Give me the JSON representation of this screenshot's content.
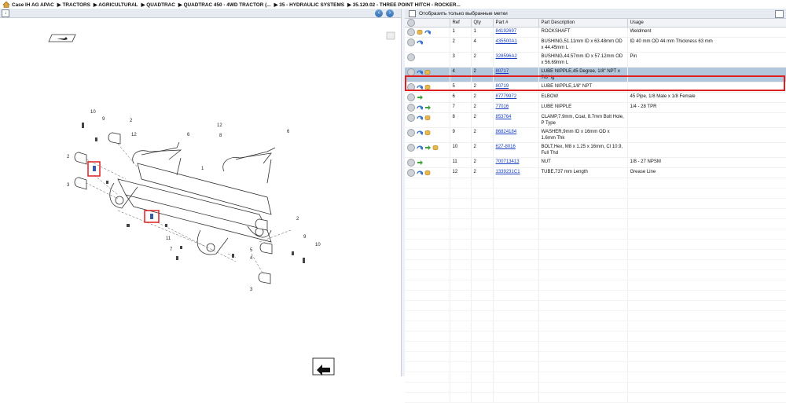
{
  "breadcrumb": [
    "Case IH AG APAC",
    "TRACTORS",
    "AGRICULTURAL",
    "QUADTRAC",
    "QUADTRAC 450 - 4WD TRACTOR (...",
    "35 - HYDRAULIC SYSTEMS",
    "35.120.02 - THREE POINT HITCH - ROCKER..."
  ],
  "right_toolbar": {
    "filter_label": "Отобразить только выбранные метки"
  },
  "table": {
    "headers": {
      "ref": "Ref",
      "qty": "Qty",
      "part": "Part #",
      "desc": "Part Description",
      "usage": "Usage"
    },
    "rows": [
      {
        "ref": "1",
        "qty": "1",
        "part": "84192697",
        "desc": "ROCKSHAFT",
        "usage": "Weldment"
      },
      {
        "ref": "2",
        "qty": "4",
        "part": "435500A1",
        "desc": "BUSHING,51.11mm ID x 63.48mm OD x 44.45mm L",
        "usage": "ID 40 mm OD 44 mm Thickness 63 mm"
      },
      {
        "ref": "3",
        "qty": "2",
        "part": "328596A2",
        "desc": "BUSHING,44.57mm ID x 57.12mm OD x 56.69mm L",
        "usage": "Pin"
      },
      {
        "ref": "4",
        "qty": "2",
        "part": "80717",
        "desc": "LUBE NIPPLE,45 Degree, 1/8\" NPT x 7/8\" lg",
        "usage": ""
      },
      {
        "ref": "5",
        "qty": "2",
        "part": "80719",
        "desc": "LUBE NIPPLE,1/8\" NPT",
        "usage": ""
      },
      {
        "ref": "6",
        "qty": "2",
        "part": "87779972",
        "desc": "ELBOW",
        "usage": "45 Pipe, 1/8 Male x 1/8 Female"
      },
      {
        "ref": "7",
        "qty": "2",
        "part": "77016",
        "desc": "LUBE NIPPLE",
        "usage": "1/4 - 28 TPR"
      },
      {
        "ref": "8",
        "qty": "2",
        "part": "853764",
        "desc": "CLAMP,7.9mm, Coat, 8.7mm Bolt Hole, P Type",
        "usage": ""
      },
      {
        "ref": "9",
        "qty": "2",
        "part": "86824184",
        "desc": "WASHER,9mm ID x 16mm OD x 1.6mm Thk",
        "usage": ""
      },
      {
        "ref": "10",
        "qty": "2",
        "part": "627-8016",
        "desc": "BOLT,Hex, M8 x 1.25 x 16mm, Cl 10.9, Full Thd",
        "usage": ""
      },
      {
        "ref": "11",
        "qty": "2",
        "part": "700713413",
        "desc": "NUT",
        "usage": "1/8 - 27 NPSM"
      },
      {
        "ref": "12",
        "qty": "2",
        "part": "1339231C1",
        "desc": "TUBE,737 mm Length",
        "usage": "Grease Line"
      }
    ]
  },
  "diagram": {
    "callouts": [
      "10",
      "9",
      "2",
      "12",
      "6",
      "12",
      "8",
      "6",
      "2",
      "3",
      "1",
      "2",
      "9",
      "10",
      "11",
      "5",
      "4",
      "7",
      "3"
    ]
  },
  "colors": {
    "selection": "#b3c7dc",
    "highlight": "#e02020",
    "toolbar": "#e6ebf2",
    "link": "#1a3fc4"
  }
}
